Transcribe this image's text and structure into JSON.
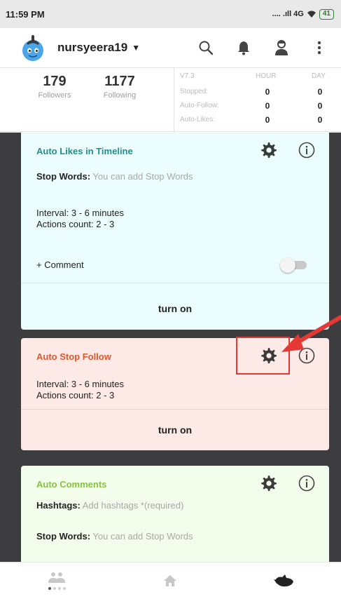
{
  "status_bar": {
    "time": "11:59 PM",
    "signal": ".... .ıll 4G",
    "wifi_icon": "wifi-icon",
    "battery": "41"
  },
  "header": {
    "username": "nursyeera19",
    "caret": "▼",
    "icons": [
      "search-icon",
      "bell-icon",
      "account-icon",
      "more-vert-icon"
    ]
  },
  "stats": {
    "followers_count": "179",
    "followers_label": "Followers",
    "following_count": "1177",
    "following_label": "Following",
    "version": "V7.3",
    "col_hour": "HOUR",
    "col_day": "DAY",
    "rows": [
      {
        "label": "Stopped:",
        "hour": "0",
        "day": "0"
      },
      {
        "label": "Auto-Follow:",
        "hour": "0",
        "day": "0"
      },
      {
        "label": "Auto-Likes:",
        "hour": "0",
        "day": "0"
      }
    ]
  },
  "cards": {
    "likes": {
      "title": "Auto Likes in Timeline",
      "title_color": "#1f8f8f",
      "stop_words_label": "Stop Words:",
      "stop_words_placeholder": "You can add Stop Words",
      "interval": "Interval: 3 - 6 minutes",
      "actions": "Actions count: 2 - 3",
      "comment_label": "+ Comment",
      "comment_toggle_on": false,
      "turn_on": "turn on"
    },
    "stop_follow": {
      "title": "Auto Stop Follow",
      "title_color": "#e0572e",
      "interval": "Interval: 3 - 6 minutes",
      "actions": "Actions count: 2 - 3",
      "turn_on": "turn on"
    },
    "comments": {
      "title": "Auto Comments",
      "title_color": "#86c440",
      "hashtags_label": "Hashtags:",
      "hashtags_placeholder": "Add hashtags *(required)",
      "stop_words_label": "Stop Words:",
      "stop_words_placeholder": "You can add Stop Words"
    }
  },
  "annotation": {
    "color": "#e53935"
  },
  "bottom_nav": {
    "items": [
      "people-icon",
      "home-icon",
      "bird-icon"
    ],
    "page_indicator": {
      "count": 4,
      "active": 0
    }
  }
}
